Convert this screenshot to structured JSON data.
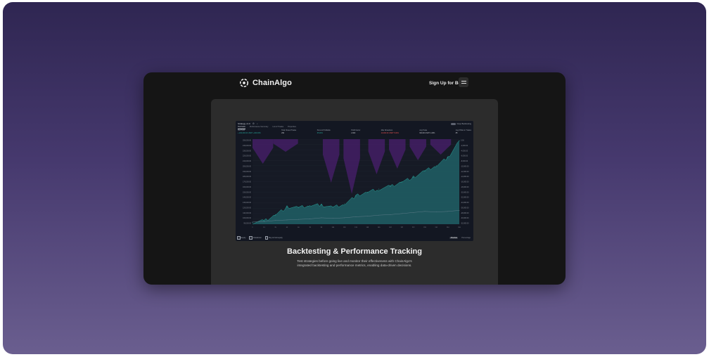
{
  "nav": {
    "brand": "ChainAlgo",
    "signup": "Sign Up for Beta"
  },
  "strategy": {
    "name": "Strategy v1.0",
    "deep_backtest_label": "Deep Backtesting",
    "tabs": [
      {
        "label": "Overview"
      },
      {
        "label": "Performance Summary"
      },
      {
        "label": "List of Trades"
      },
      {
        "label": "Properties"
      }
    ],
    "stats": [
      {
        "label": "Net Profit",
        "value": "+ 200,000.00 USDT  +400.00%",
        "tone": "pos"
      },
      {
        "label": "Total Closed Trades",
        "value": "290",
        "tone": "neu"
      },
      {
        "label": "Percent Profitable",
        "value": "65.00%",
        "tone": "pos"
      },
      {
        "label": "Profit Factor",
        "value": "2.000",
        "tone": "neu"
      },
      {
        "label": "Max Drawdown",
        "value": "10,000.00 USDT  5.00%",
        "tone": "neg"
      },
      {
        "label": "Avg Trade",
        "value": "600.00 USDT  1.20%",
        "tone": "neu"
      },
      {
        "label": "Avg # Bars in Trades",
        "value": "85",
        "tone": "neu"
      }
    ],
    "legend": [
      {
        "label": "Equity"
      },
      {
        "label": "Drawdown"
      },
      {
        "label": "Buy & hold equity"
      }
    ],
    "view_modes": [
      "Absolute",
      "Percentage"
    ]
  },
  "chart_data": {
    "type": "area",
    "x": [
      "2",
      "13",
      "25",
      "43",
      "60",
      "78",
      "93",
      "106",
      "118",
      "133",
      "149",
      "165",
      "182",
      "197",
      "212",
      "226",
      "241",
      "254",
      "266"
    ],
    "y_left_ticks": [
      "250,000.00",
      "240,000.00",
      "230,000.00",
      "220,000.00",
      "210,000.00",
      "200,000.00",
      "190,000.00",
      "180,000.00",
      "170,000.00",
      "160,000.00",
      "150,000.00",
      "140,000.00",
      "130,000.00",
      "120,000.00",
      "110,000.00",
      "100,000.00",
      "90,000.00"
    ],
    "y_right_ticks": [
      "0.00",
      "-2,000.00",
      "-4,000.00",
      "-6,000.00",
      "-8,000.00",
      "-10,000.00",
      "-12,000.00",
      "-14,000.00",
      "-16,000.00",
      "-18,000.00",
      "-20,000.00",
      "-22,000.00",
      "-24,000.00",
      "-26,000.00",
      "-28,000.00",
      "-30,000.00",
      "-32,000.00"
    ],
    "ylim": [
      90000,
      250000
    ],
    "series": [
      {
        "name": "Equity",
        "color": "#26a69a",
        "values": [
          93000,
          96000,
          108000,
          122000,
          121000,
          125000,
          126000,
          122000,
          128000,
          143000,
          150000,
          156000,
          161000,
          170000,
          178000,
          190000,
          200000,
          215000,
          247000
        ]
      },
      {
        "name": "Buy & hold equity",
        "color": "#5c7a87",
        "values": [
          94000,
          95000,
          97000,
          98000,
          99000,
          100000,
          102000,
          101000,
          102000,
          104000,
          105000,
          107000,
          108000,
          110000,
          112000,
          114000,
          113000,
          114000,
          116000
        ]
      }
    ],
    "drawdown_color": "#4a1f6e"
  },
  "feature": {
    "title": "Backtesting & Performance Tracking",
    "desc_line1": "Test strategies before going live and monitor their effectiveness with ChainAlgo's",
    "desc_line2": "integrated backtesting and performance metrics, enabling data-driven decisions."
  }
}
